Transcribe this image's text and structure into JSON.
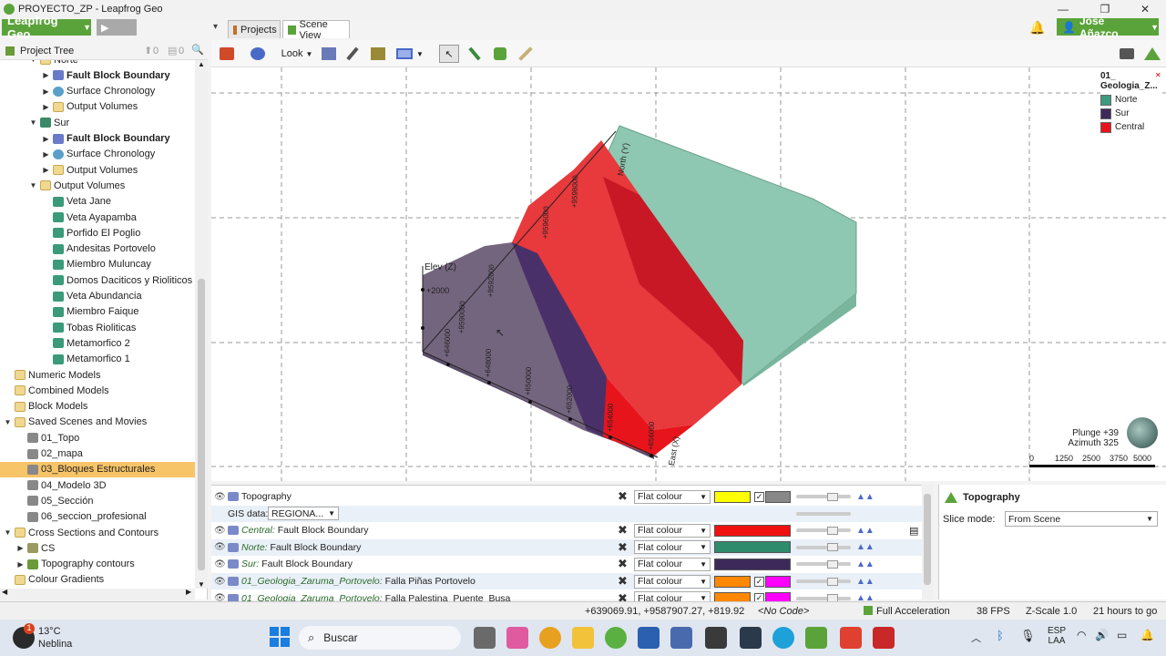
{
  "window": {
    "title": "PROYECTO_ZP - Leapfrog Geo"
  },
  "app": {
    "brand": "Leapfrog Geo",
    "user": "José Añazco"
  },
  "tabs": [
    {
      "label": "Projects"
    },
    {
      "label": "Scene View"
    }
  ],
  "toolbar": {
    "look_label": "Look"
  },
  "tree": {
    "header": "Project Tree",
    "header_counts": [
      "0",
      "0"
    ],
    "items": [
      {
        "label": "Norte",
        "bold": false
      },
      {
        "label": "Fault Block Boundary",
        "bold": true
      },
      {
        "label": "Surface Chronology",
        "bold": false
      },
      {
        "label": "Output Volumes",
        "bold": false
      },
      {
        "label": "Sur",
        "bold": false
      },
      {
        "label": "Fault Block Boundary",
        "bold": true
      },
      {
        "label": "Surface Chronology",
        "bold": false
      },
      {
        "label": "Output Volumes",
        "bold": false
      },
      {
        "label": "Output Volumes",
        "bold": false
      },
      {
        "label": "Veta Jane",
        "bold": false
      },
      {
        "label": "Veta Ayapamba",
        "bold": false
      },
      {
        "label": "Porfido El Poglio",
        "bold": false
      },
      {
        "label": "Andesitas Portovelo",
        "bold": false
      },
      {
        "label": "Miembro Muluncay",
        "bold": false
      },
      {
        "label": "Domos Daciticos y Rioliticos",
        "bold": false
      },
      {
        "label": "Veta Abundancia",
        "bold": false
      },
      {
        "label": "Miembro Faique",
        "bold": false
      },
      {
        "label": "Tobas Rioliticas",
        "bold": false
      },
      {
        "label": "Metamorfico 2",
        "bold": false
      },
      {
        "label": "Metamorfico 1",
        "bold": false
      },
      {
        "label": "Numeric Models",
        "bold": false
      },
      {
        "label": "Combined Models",
        "bold": false
      },
      {
        "label": "Block Models",
        "bold": false
      },
      {
        "label": "Saved Scenes and Movies",
        "bold": false
      },
      {
        "label": "01_Topo",
        "bold": false
      },
      {
        "label": "02_mapa",
        "bold": false
      },
      {
        "label": "03_Bloques Estructurales",
        "bold": false
      },
      {
        "label": "04_Modelo 3D",
        "bold": false
      },
      {
        "label": "05_Sección",
        "bold": false
      },
      {
        "label": "06_seccion_profesional",
        "bold": false
      },
      {
        "label": "Cross Sections and Contours",
        "bold": false
      },
      {
        "label": "CS",
        "bold": false
      },
      {
        "label": "Topography contours",
        "bold": false
      },
      {
        "label": "Colour Gradients",
        "bold": false
      }
    ]
  },
  "scene": {
    "legend": {
      "title": "01_\nGeologia_Z...",
      "items": [
        {
          "label": "Norte",
          "color": "#3d9a7c"
        },
        {
          "label": "Sur",
          "color": "#3e2a5a"
        },
        {
          "label": "Central",
          "color": "#e8141c"
        }
      ]
    },
    "axis_labels": {
      "elev": "Elev (Z)",
      "north": "North (Y)",
      "east": "East (X)"
    },
    "ticks": [
      "+2000",
      "+646000",
      "+648000",
      "+650000",
      "+652000",
      "+654000",
      "+656000",
      "+658000",
      "+9588000",
      "+9590000",
      "+9592000",
      "+9594000",
      "+9596000",
      "+9598000"
    ],
    "plunge": "Plunge +39",
    "azimuth": "Azimuth 325",
    "scale_ticks": [
      "0",
      "1250",
      "2500",
      "3750",
      "5000"
    ]
  },
  "shapelist": {
    "rows": [
      {
        "name": "Topography",
        "prefix": "",
        "mode": "Flat colour",
        "color": "#ffff00",
        "color2": "#888888"
      },
      {
        "name": "GIS data:",
        "prefix": "",
        "mode": "REGIONA...",
        "color": "",
        "color2": ""
      },
      {
        "name": "Fault Block Boundary",
        "prefix": "Central:",
        "mode": "Flat colour",
        "color": "#f01010",
        "color2": ""
      },
      {
        "name": "Fault Block Boundary",
        "prefix": "Norte:",
        "mode": "Flat colour",
        "color": "#2e8c6c",
        "color2": ""
      },
      {
        "name": "Fault Block Boundary",
        "prefix": "Sur:",
        "mode": "Flat colour",
        "color": "#3e2a5a",
        "color2": ""
      },
      {
        "name": "Falla Piñas Portovelo",
        "prefix": "01_Geologia_Zaruma_Portovelo:",
        "mode": "Flat colour",
        "color": "#ff8800",
        "color2": "#ff00ff"
      },
      {
        "name": "Falla Palestina_Puente_Busa",
        "prefix": "01_Geologia_Zaruma_Portovelo:",
        "mode": "Flat colour",
        "color": "#ff8800",
        "color2": "#ff00ff"
      }
    ]
  },
  "props": {
    "title": "Topography",
    "slice_mode_label": "Slice mode:",
    "slice_mode_value": "From Scene"
  },
  "status": {
    "coords": "+639069.91, +9587907.27, +819.92",
    "code": "<No Code>",
    "accel": "Full Acceleration",
    "fps": "38 FPS",
    "zscale": "Z-Scale 1.0",
    "time": "21 hours to go"
  },
  "taskbar": {
    "weather_temp": "13°C",
    "weather_desc": "Neblina",
    "weather_badge": "1",
    "search": "Buscar",
    "lang1": "ESP",
    "lang2": "LAA"
  }
}
